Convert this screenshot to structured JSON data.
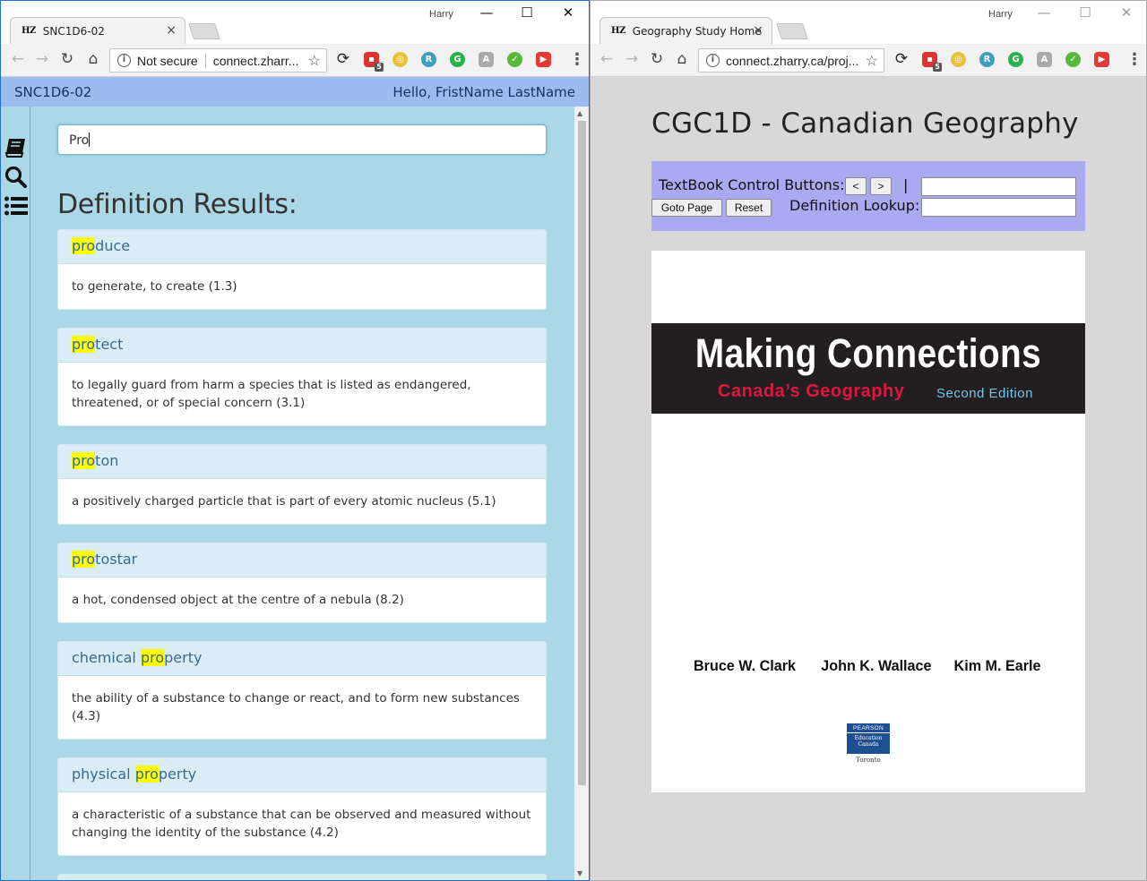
{
  "left_window": {
    "profile_name": "Harry",
    "tab_favicon": "HZ",
    "tab_title": "SNC1D6-02",
    "tab_close": "×",
    "url_security": "Not secure",
    "url": "connect.zharr...",
    "controls": {
      "minimize": "—",
      "maximize": "☐",
      "close": "✕"
    },
    "ext_badge": "5"
  },
  "right_window": {
    "profile_name": "Harry",
    "tab_favicon": "HZ",
    "tab_title": "Geography Study Home",
    "tab_close": "×",
    "url": "connect.zharry.ca/proj...",
    "controls": {
      "minimize": "—",
      "maximize": "☐",
      "close": "✕"
    },
    "ext_badge": "5"
  },
  "app": {
    "course_code": "SNC1D6-02",
    "greeting": "Hello, FristName LastName",
    "sidebar_icons": [
      "book-icon",
      "search-icon",
      "list-icon"
    ],
    "search_value": "Pro",
    "results_heading": "Definition Results:",
    "highlight_color": "#ffff00",
    "results": [
      {
        "pre": "",
        "match": "pro",
        "post": "duce",
        "definition": "to generate, to create (1.3)"
      },
      {
        "pre": "",
        "match": "pro",
        "post": "tect",
        "definition": "to legally guard from harm a species that is listed as endangered, threatened, or of special concern (3.1)"
      },
      {
        "pre": "",
        "match": "pro",
        "post": "ton",
        "definition": "a positively charged particle that is part of every atomic nucleus (5.1)"
      },
      {
        "pre": "",
        "match": "pro",
        "post": "tostar",
        "definition": "a hot, condensed object at the centre of a nebula (8.2)"
      },
      {
        "pre": "chemical ",
        "match": "pro",
        "post": "perty",
        "definition": "the ability of a substance to change or react, and to form new substances (4.3)"
      },
      {
        "pre": "physical ",
        "match": "pro",
        "post": "perty",
        "definition": "a characteristic of a substance that can be observed and measured without changing the identity of the substance (4.2)"
      }
    ]
  },
  "geo": {
    "page_title": "CGC1D - Canadian Geography",
    "textbook_label": "TextBook Control Buttons:",
    "prev_label": "<",
    "next_label": ">",
    "divider": "|",
    "goto_label": "Goto Page",
    "reset_label": "Reset",
    "definition_label": "Definition Lookup:",
    "panel_color": "#aaaaf3",
    "book": {
      "title": "Making Connections",
      "subtitle": "Canada’s Geography",
      "edition": "Second Edition",
      "authors": [
        "Bruce W. Clark",
        "John K. Wallace",
        "Kim M. Earle"
      ],
      "publisher_lines": [
        "PEARSON",
        "Education",
        "Canada"
      ],
      "publisher_city": "Toronto"
    }
  }
}
